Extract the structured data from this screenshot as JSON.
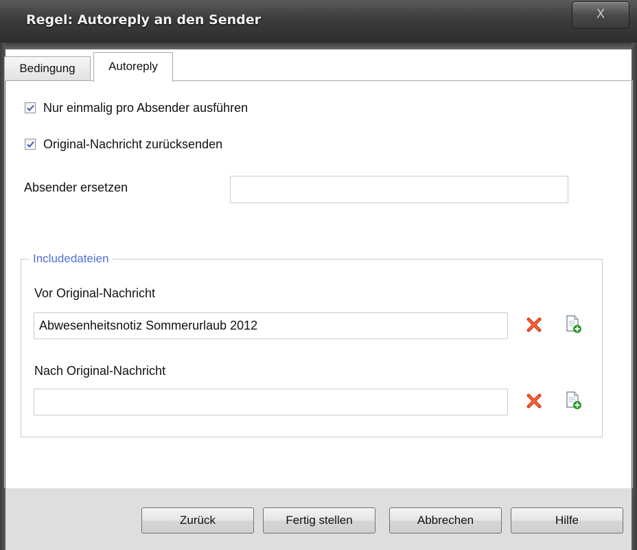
{
  "window": {
    "title": "Regel: Autoreply an den Sender",
    "close_glyph": "X"
  },
  "tabs": [
    {
      "label": "Bedingung",
      "active": false
    },
    {
      "label": "Autoreply",
      "active": true
    }
  ],
  "options": {
    "once_per_sender": {
      "label": "Nur einmalig pro Absender ausführen",
      "checked": true
    },
    "return_original": {
      "label": "Original-Nachricht zurücksenden",
      "checked": true
    }
  },
  "replace_sender": {
    "label": "Absender ersetzen",
    "value": ""
  },
  "include_files": {
    "legend": "Includedateien",
    "before_label": "Vor Original-Nachricht",
    "before_value": "Abwesenheitsnotiz Sommerurlaub 2012",
    "after_label": "Nach Original-Nachricht",
    "after_value": "",
    "delete_icon": "delete-icon",
    "add_file_icon": "add-file-icon"
  },
  "buttons": {
    "back": "Zurück",
    "finish": "Fertig stellen",
    "cancel": "Abbrechen",
    "help": "Hilfe"
  },
  "colors": {
    "legend": "#4f6fd6",
    "delete": "#e0401c",
    "add": "#2e9a2e"
  }
}
